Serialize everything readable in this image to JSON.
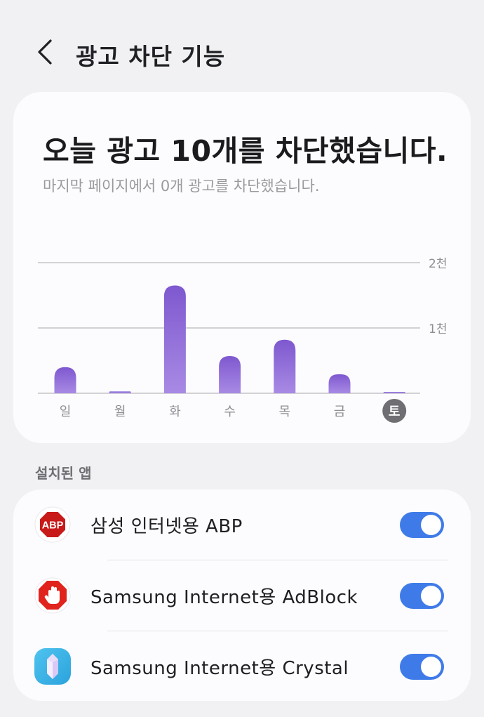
{
  "header": {
    "title": "광고 차단 기능"
  },
  "stats": {
    "title": "오늘 광고 10개를 차단했습니다.",
    "subtitle": "마지막 페이지에서 0개 광고를 차단했습니다."
  },
  "chart_data": {
    "type": "bar",
    "categories": [
      "일",
      "월",
      "화",
      "수",
      "목",
      "금",
      "토"
    ],
    "values": [
      400,
      30,
      1650,
      570,
      820,
      290,
      10
    ],
    "selected_category": "토",
    "y_ticks": [
      1000,
      2000
    ],
    "y_tick_labels": [
      "1천",
      "2천"
    ],
    "ylim": [
      0,
      2000
    ],
    "bar_color": "#8a66d6",
    "selected_color": "#6e6e73",
    "grid": true
  },
  "apps_section": {
    "label": "설치된 앱"
  },
  "apps": [
    {
      "name": "삼성 인터넷용 ABP",
      "icon": "abp-icon",
      "enabled": true
    },
    {
      "name": "Samsung Internet용 AdBlock",
      "icon": "adblock-hand-icon",
      "enabled": true
    },
    {
      "name": "Samsung Internet용 Crystal",
      "icon": "crystal-icon",
      "enabled": true
    }
  ],
  "colors": {
    "accent": "#3f7be8",
    "background": "#f1f1f3",
    "card": "#fcfcfe"
  }
}
